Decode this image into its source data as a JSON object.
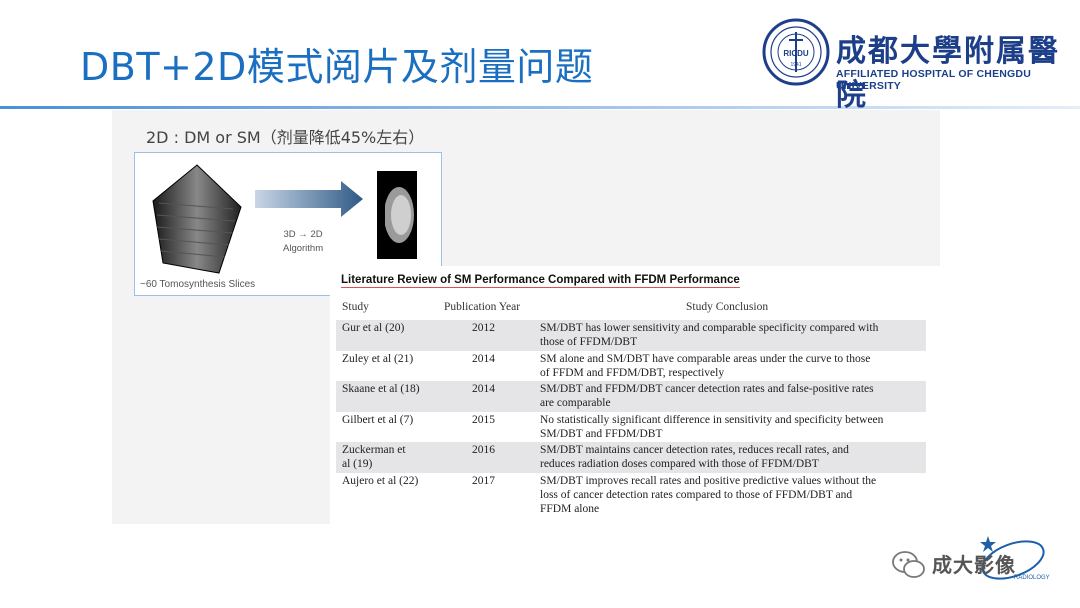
{
  "slide": {
    "title": "DBT+2D模式阅片及剂量问题"
  },
  "logo": {
    "name_cn": "成都大學附属醫院",
    "name_en": "AFFILIATED HOSPITAL OF CHENGDU UNIVERSITY",
    "seal_text": "RICDU",
    "seal_year": "1941",
    "colors": {
      "primary": "#1d3f8a"
    }
  },
  "figure": {
    "heading": "2D : DM or SM（剂量降低45%左右）",
    "slices_label": "~60 Tomosynthesis Slices",
    "algorithm_label_line1": "3D → 2D",
    "algorithm_label_line2": "Algorithm"
  },
  "table": {
    "title": "Literature Review of SM Performance Compared with FFDM Performance",
    "columns": [
      "Study",
      "Publication Year",
      "Study Conclusion"
    ],
    "rows": [
      {
        "study": "Gur et al (20)",
        "year": "2012",
        "conclusion": "SM/DBT has lower sensitivity and comparable specificity compared with\nthose of FFDM/DBT"
      },
      {
        "study": "Zuley et al (21)",
        "year": "2014",
        "conclusion": "SM alone and SM/DBT have comparable areas under the curve to those\nof FFDM and FFDM/DBT, respectively"
      },
      {
        "study": "Skaane et al (18)",
        "year": "2014",
        "conclusion": "SM/DBT and FFDM/DBT cancer detection rates and false-positive rates\nare comparable"
      },
      {
        "study": "Gilbert et al (7)",
        "year": "2015",
        "conclusion": "No statistically significant difference in sensitivity and specificity between\nSM/DBT and FFDM/DBT"
      },
      {
        "study": "Zuckerman et\nal (19)",
        "year": "2016",
        "conclusion": "SM/DBT maintains cancer detection rates, reduces recall rates, and\nreduces radiation doses compared with those of FFDM/DBT"
      },
      {
        "study": "Aujero et al (22)",
        "year": "2017",
        "conclusion": "SM/DBT improves recall rates and positive predictive values without the\nloss of cancer detection rates compared to those of FFDM/DBT and\nFFDM alone"
      }
    ]
  },
  "watermark": {
    "text": "成大影像",
    "sub": "RADIOLOGY"
  }
}
